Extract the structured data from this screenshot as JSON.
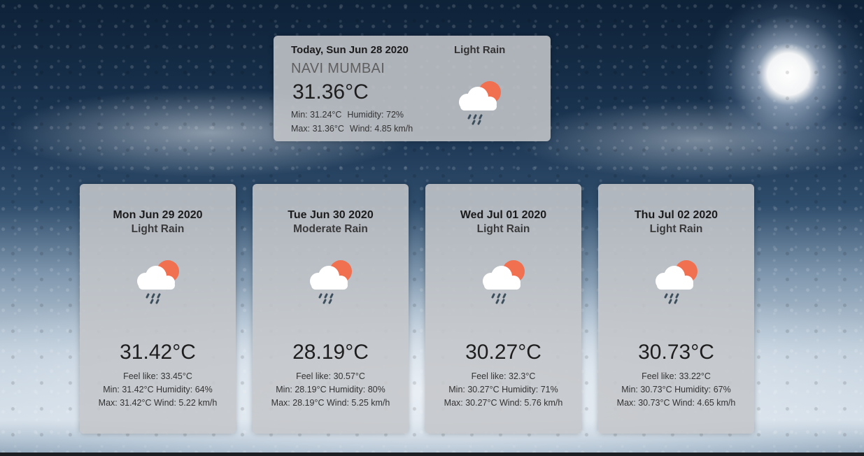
{
  "today": {
    "date": "Today, Sun Jun 28 2020",
    "city": "NAVI MUMBAI",
    "temp": "31.36°C",
    "desc": "Light Rain",
    "min_label": "Min:",
    "min": "31.24°C",
    "humidity_label": "Humidity:",
    "humidity": "72%",
    "max_label": "Max:",
    "max": "31.36°C",
    "wind_label": "Wind:",
    "wind": "4.85 km/h",
    "icon": "rain-cloud-sun-icon"
  },
  "forecast": [
    {
      "date": "Mon Jun 29 2020",
      "desc": "Light Rain",
      "temp": "31.42°C",
      "feel": "Feel like: 33.45°C",
      "min_hum": "Min: 31.42°C  Humidity: 64%",
      "max_wind": "Max: 31.42°C  Wind: 5.22 km/h",
      "icon": "rain-cloud-sun-icon"
    },
    {
      "date": "Tue Jun 30 2020",
      "desc": "Moderate Rain",
      "temp": "28.19°C",
      "feel": "Feel like: 30.57°C",
      "min_hum": "Min: 28.19°C  Humidity: 80%",
      "max_wind": "Max: 28.19°C  Wind: 5.25 km/h",
      "icon": "rain-cloud-sun-icon"
    },
    {
      "date": "Wed Jul 01 2020",
      "desc": "Light Rain",
      "temp": "30.27°C",
      "feel": "Feel like: 32.3°C",
      "min_hum": "Min: 30.27°C  Humidity: 71%",
      "max_wind": "Max: 30.27°C  Wind: 5.76 km/h",
      "icon": "rain-cloud-sun-icon"
    },
    {
      "date": "Thu Jul 02 2020",
      "desc": "Light Rain",
      "temp": "30.73°C",
      "feel": "Feel like: 33.22°C",
      "min_hum": "Min: 30.73°C  Humidity: 67%",
      "max_wind": "Max: 30.73°C  Wind: 4.65 km/h",
      "icon": "rain-cloud-sun-icon"
    }
  ],
  "colors": {
    "sun": "#f07050",
    "cloud": "#ffffff",
    "rain": "#3d4e5c",
    "card": "#c4c6c9"
  }
}
